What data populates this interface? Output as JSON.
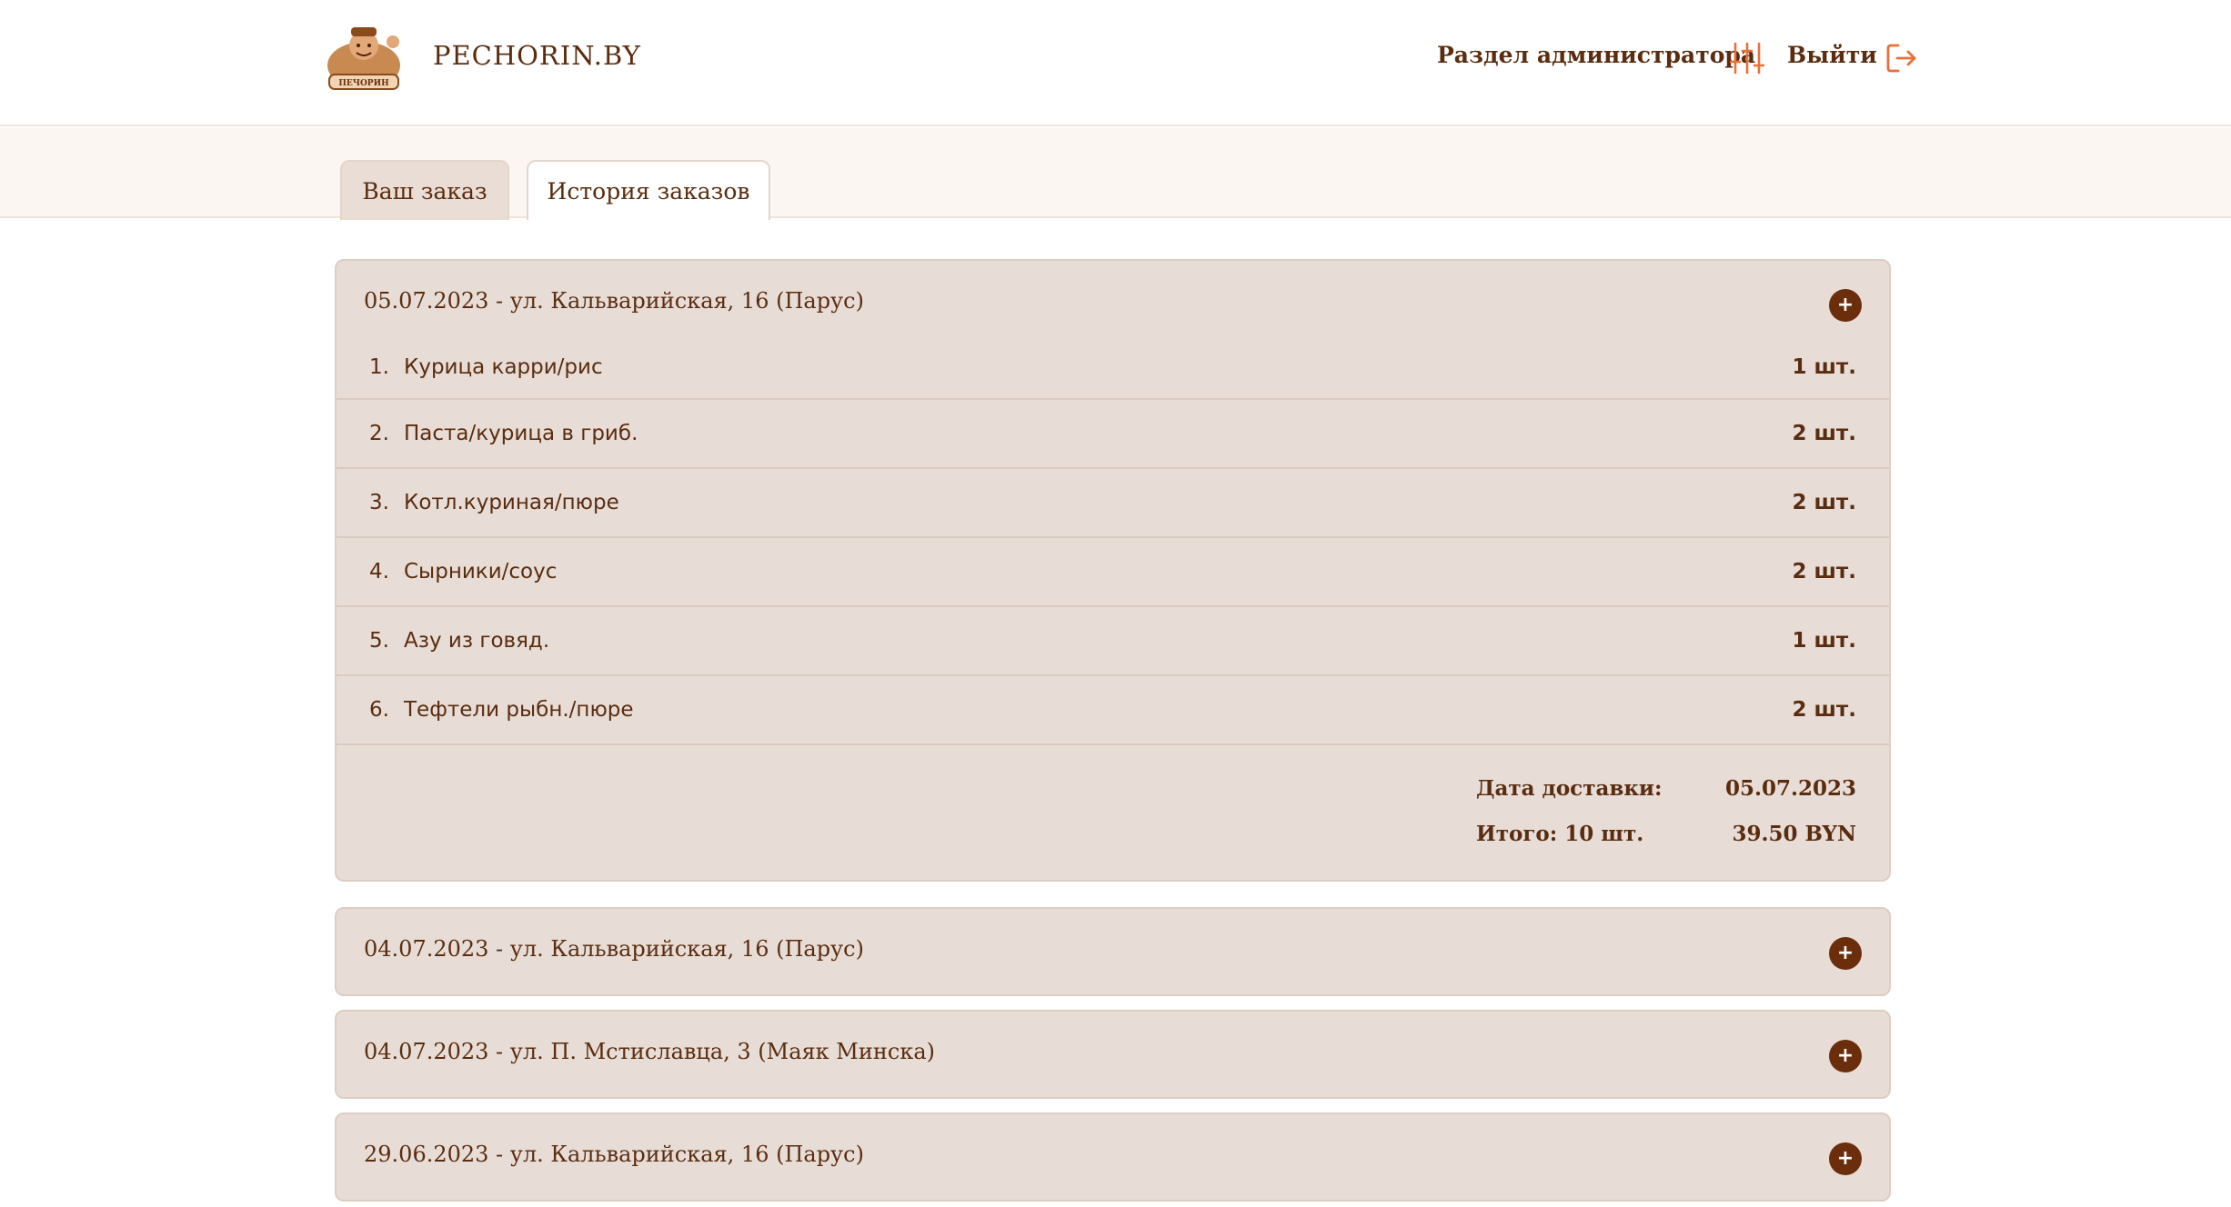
{
  "header": {
    "brand": "PECHORIN.BY",
    "admin_label": "Раздел администратора",
    "logout_label": "Выйти"
  },
  "tabs": [
    {
      "label": "Ваш заказ",
      "active": false
    },
    {
      "label": "История заказов",
      "active": true
    }
  ],
  "orders": [
    {
      "title": "05.07.2023 - ул. Кальварийская, 16 (Парус)",
      "expanded": true,
      "items": [
        {
          "num": "1.",
          "name": "Курица карри/рис",
          "qty": "1 шт."
        },
        {
          "num": "2.",
          "name": "Паста/курица в гриб.",
          "qty": "2 шт."
        },
        {
          "num": "3.",
          "name": "Котл.куриная/пюре",
          "qty": "2 шт."
        },
        {
          "num": "4.",
          "name": "Сырники/соус",
          "qty": "2 шт."
        },
        {
          "num": "5.",
          "name": "Азу из говяд.",
          "qty": "1 шт."
        },
        {
          "num": "6.",
          "name": "Тефтели рыбн./пюре",
          "qty": "2 шт."
        }
      ],
      "delivery_label": "Дата доставки:",
      "delivery_value": "05.07.2023",
      "total_label": "Итого: 10 шт.",
      "total_value": "39.50 BYN"
    },
    {
      "title": "04.07.2023 - ул. Кальварийская, 16 (Парус)",
      "expanded": false
    },
    {
      "title": "04.07.2023 - ул. П. Мстиславца, 3 (Маяк Минска)",
      "expanded": false
    },
    {
      "title": "29.06.2023 - ул. Кальварийская, 16 (Парус)",
      "expanded": false
    }
  ],
  "icons": {
    "logo": "pechorin-logo",
    "admin": "sliders-icon",
    "logout": "logout-icon",
    "expand": "plus-icon"
  },
  "colors": {
    "accent_brown": "#6b2e0c",
    "text_brown": "#5a2d10",
    "card_bg": "#e8ddd6",
    "icon_orange": "#e8703a"
  },
  "expand_glyph": "+"
}
